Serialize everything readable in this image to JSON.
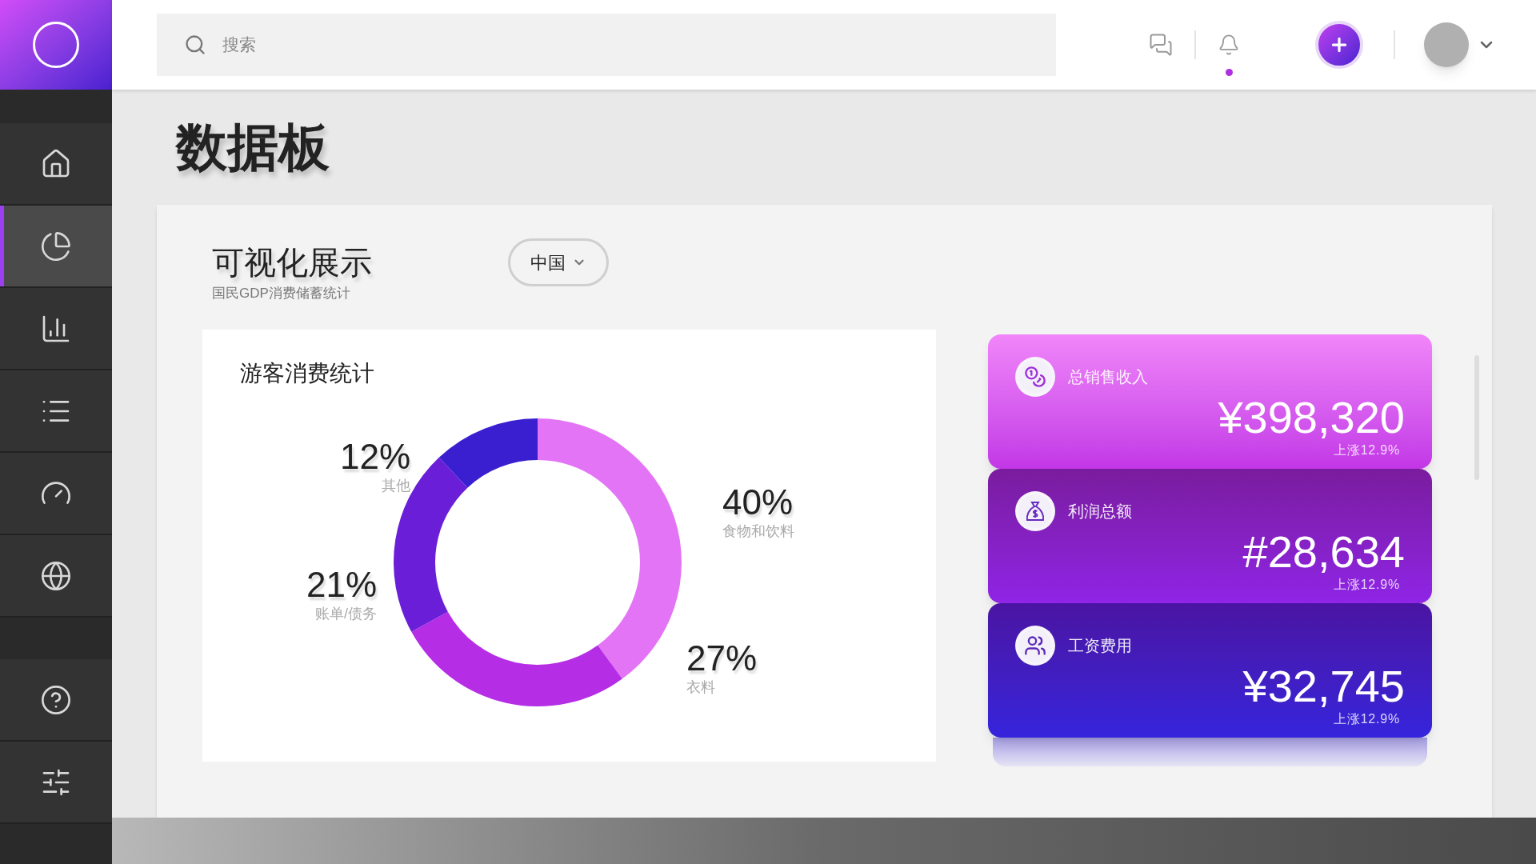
{
  "sidebar": {
    "items": [
      {
        "kind": "home",
        "selected": false
      },
      {
        "kind": "pie",
        "selected": true
      },
      {
        "kind": "bars",
        "selected": false
      },
      {
        "kind": "list",
        "selected": false
      },
      {
        "kind": "gauge",
        "selected": false
      },
      {
        "kind": "globe",
        "selected": false
      }
    ],
    "bottom_items": [
      {
        "kind": "help",
        "selected": false
      },
      {
        "kind": "sliders",
        "selected": false
      }
    ]
  },
  "search": {
    "placeholder": "搜索"
  },
  "notifications": {
    "unread": true
  },
  "page_title": "数据板",
  "section": {
    "title": "可视化展示",
    "subtitle": "国民GDP消费储蓄统计",
    "region_select": {
      "value": "中国"
    }
  },
  "chart_card": {
    "title": "游客消费统计",
    "chart_data": {
      "type": "donut",
      "categories": [
        "食物和饮料",
        "衣料",
        "账单/债务",
        "其他"
      ],
      "values": [
        40,
        27,
        21,
        12
      ],
      "value_labels": [
        "40%",
        "27%",
        "21%",
        "12%"
      ]
    }
  },
  "stats": [
    {
      "kind": "coins",
      "title": "总销售收入",
      "value": "¥398,320",
      "change": "上涨12.9%"
    },
    {
      "kind": "bag",
      "title": "利润总额",
      "value": "#28,634",
      "change": "上涨12.9%"
    },
    {
      "kind": "people",
      "title": "工资费用",
      "value": "¥32,745",
      "change": "上涨12.9%"
    }
  ]
}
